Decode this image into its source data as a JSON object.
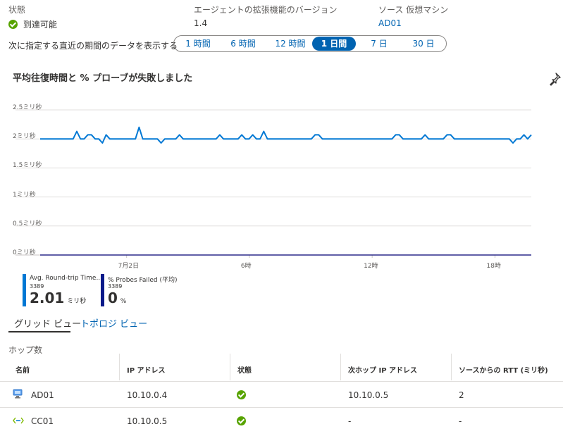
{
  "header": {
    "status_label": "状態",
    "status_value": "到達可能",
    "agent_label": "エージェントの拡張機能のバージョン",
    "agent_value": "1.4",
    "source_label": "ソース 仮想マシン",
    "source_value": "AD01"
  },
  "time_range": {
    "prompt": "次に指定する直近の期間のデータを表示する",
    "options": [
      "1 時間",
      "6 時間",
      "12 時間",
      "1 日間",
      "7 日",
      "30 日"
    ],
    "selected": "1 日間"
  },
  "chart_title": "平均往復時間と % プローブが失敗しました",
  "chart_data": {
    "type": "line",
    "title": "平均往復時間と % プローブが失敗しました",
    "y_unit": "ミリ秒",
    "ylim": [
      0,
      2.5
    ],
    "y_ticks": [
      "2.5ミリ秒",
      "2ミリ秒",
      "1.5ミリ秒",
      "1ミリ秒",
      "0.5ミリ秒",
      "0ミリ秒"
    ],
    "x_ticks": [
      "7月2日",
      "6時",
      "12時",
      "18時"
    ],
    "grid": true,
    "series": [
      {
        "name": "Avg. Round-trip Time...",
        "color": "#0078d4",
        "values": [
          2,
          2,
          2,
          2,
          2,
          2,
          2,
          2,
          2,
          2,
          2.13,
          2,
          2,
          2.07,
          2.07,
          2,
          2,
          1.93,
          2.07,
          2,
          2,
          2,
          2,
          2,
          2,
          2,
          2,
          2.2,
          2,
          2,
          2,
          2,
          2,
          1.93,
          2,
          2,
          2,
          2,
          2.07,
          2,
          2,
          2,
          2,
          2,
          2,
          2,
          2,
          2,
          2,
          2.07,
          2,
          2,
          2,
          2,
          2,
          2.07,
          2,
          2,
          2.07,
          2,
          2,
          2.13,
          2,
          2,
          2,
          2,
          2,
          2,
          2,
          2,
          2,
          2,
          2,
          2,
          2,
          2.07,
          2.07,
          2,
          2,
          2,
          2,
          2,
          2,
          2,
          2,
          2,
          2,
          2,
          2,
          2,
          2,
          2,
          2,
          2,
          2,
          2,
          2,
          2.07,
          2.07,
          2,
          2,
          2,
          2,
          2,
          2,
          2.07,
          2,
          2,
          2,
          2,
          2,
          2.07,
          2.07,
          2,
          2,
          2,
          2,
          2,
          2,
          2,
          2,
          2,
          2,
          2,
          2,
          2,
          2,
          2,
          2,
          1.93,
          2,
          2,
          2.07,
          2,
          2.07
        ]
      },
      {
        "name": "% Probes Failed (平均)",
        "color": "#2b2a8a",
        "values": [
          0,
          0
        ]
      }
    ]
  },
  "legend": [
    {
      "name": "Avg. Round-trip Time...",
      "count": "3389",
      "value": "2.01",
      "unit": "ミリ秒",
      "color": "#0078d4"
    },
    {
      "name": "% Probes Failed (平均)",
      "count": "3389",
      "value": "0",
      "unit": "%",
      "color": "#0b1a8a"
    }
  ],
  "tabs": [
    "グリッド ビュー",
    "トポロジ ビュー"
  ],
  "hops_label": "ホップ数",
  "table": {
    "columns": [
      "名前",
      "IP アドレス",
      "状態",
      "次ホップ IP アドレス",
      "ソースからの RTT (ミリ秒)"
    ],
    "rows": [
      {
        "name": "AD01",
        "ip": "10.10.0.4",
        "next_hop": "10.10.0.5",
        "rtt": "2",
        "icon": "vm-icon"
      },
      {
        "name": "CC01",
        "ip": "10.10.0.5",
        "next_hop": "-",
        "rtt": "-",
        "icon": "connection-icon"
      }
    ]
  },
  "pin_icon": "pin-icon"
}
